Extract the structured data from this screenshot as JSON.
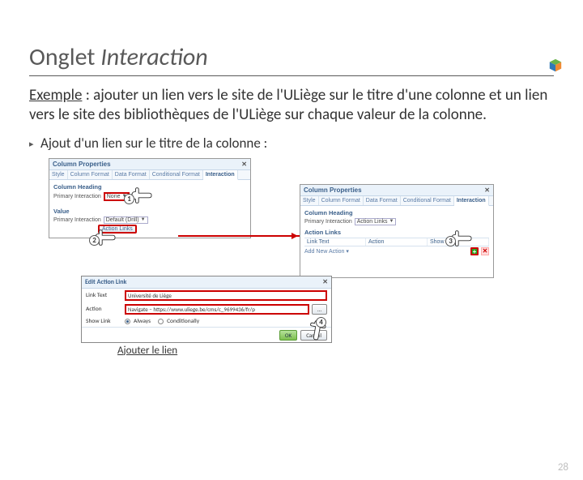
{
  "logo": {
    "name": "cube-logo"
  },
  "title": {
    "prefix": "Onglet ",
    "emph": "Interaction"
  },
  "example": {
    "label": "Exemple",
    "text": " : ajouter un lien vers le site de l'ULiège sur le titre d'une colonne et un lien vers le site des bibliothèques de l'ULiège sur chaque valeur de la colonne."
  },
  "sub": "Ajout d'un lien sur le titre de la colonne :",
  "panel1": {
    "title": "Column Properties",
    "close": "✕",
    "tabs": [
      "Style",
      "Column Format",
      "Data Format",
      "Conditional Format",
      "Interaction"
    ],
    "section1": "Column Heading",
    "label_pi": "Primary Interaction",
    "dd_none": "None",
    "section2": "Value",
    "dd_default": "Default (Drill)",
    "btn_action": "Action Links"
  },
  "panel2": {
    "title": "Column Properties",
    "tabs": [
      "Style",
      "Column Format",
      "Data Format",
      "Conditional Format",
      "Interaction"
    ],
    "section1": "Column Heading",
    "label_pi": "Primary Interaction",
    "dd_al": "Action Links",
    "section_al": "Action Links",
    "th": [
      "Link Text",
      "Action",
      "Show Link"
    ],
    "row1": "Add New Action ▾"
  },
  "edit": {
    "title": "Edit Action Link",
    "close": "✕",
    "label_linktext": "Link Text",
    "val_linktext": "Université de Liège",
    "label_action": "Action",
    "val_action": "Navigate – https://www.uliege.be/cms/c_9699436/fr/p",
    "label_showlink": "Show Link",
    "r_always": "Always",
    "r_cond": "Conditionally",
    "btn_ok": "OK",
    "btn_cancel": "Cancel"
  },
  "badges": {
    "b1": "1",
    "b2": "2",
    "b3": "3",
    "b4": "4"
  },
  "caption": "Ajouter le lien",
  "page": "28"
}
